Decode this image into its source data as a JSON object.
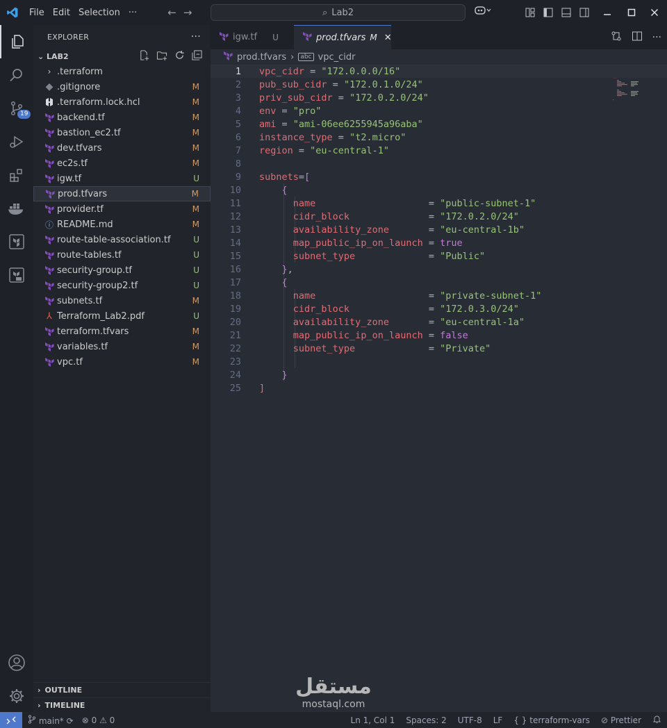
{
  "titlebar": {
    "menu": [
      "File",
      "Edit",
      "Selection",
      "···"
    ],
    "search": "Lab2"
  },
  "activity": {
    "source_control_badge": "19"
  },
  "explorer": {
    "title": "EXPLORER",
    "folder": "LAB2",
    "files": [
      {
        "name": ".terraform",
        "status": "",
        "kind": "folder"
      },
      {
        "name": ".gitignore",
        "status": "M",
        "kind": "git"
      },
      {
        "name": ".terraform.lock.hcl",
        "status": "M",
        "kind": "hcl"
      },
      {
        "name": "backend.tf",
        "status": "M",
        "kind": "tf"
      },
      {
        "name": "bastion_ec2.tf",
        "status": "M",
        "kind": "tf"
      },
      {
        "name": "dev.tfvars",
        "status": "M",
        "kind": "tf"
      },
      {
        "name": "ec2s.tf",
        "status": "M",
        "kind": "tf"
      },
      {
        "name": "igw.tf",
        "status": "U",
        "kind": "tf"
      },
      {
        "name": "prod.tfvars",
        "status": "M",
        "kind": "tf"
      },
      {
        "name": "provider.tf",
        "status": "M",
        "kind": "tf"
      },
      {
        "name": "README.md",
        "status": "M",
        "kind": "info"
      },
      {
        "name": "route-table-association.tf",
        "status": "U",
        "kind": "tf"
      },
      {
        "name": "route-tables.tf",
        "status": "U",
        "kind": "tf"
      },
      {
        "name": "security-group.tf",
        "status": "U",
        "kind": "tf"
      },
      {
        "name": "security-group2.tf",
        "status": "U",
        "kind": "tf"
      },
      {
        "name": "subnets.tf",
        "status": "M",
        "kind": "tf"
      },
      {
        "name": "Terraform_Lab2.pdf",
        "status": "U",
        "kind": "pdf"
      },
      {
        "name": "terraform.tfvars",
        "status": "M",
        "kind": "tf"
      },
      {
        "name": "variables.tf",
        "status": "M",
        "kind": "tf"
      },
      {
        "name": "vpc.tf",
        "status": "M",
        "kind": "tf"
      }
    ],
    "selected": "prod.tfvars",
    "outline": "OUTLINE",
    "timeline": "TIMELINE"
  },
  "tabs": [
    {
      "name": "igw.tf",
      "mark": "U",
      "active": false
    },
    {
      "name": "prod.tfvars",
      "mark": "M",
      "active": true
    }
  ],
  "breadcrumb": {
    "file": "prod.tfvars",
    "symbol": "vpc_cidr"
  },
  "code": [
    {
      "n": "1",
      "t": [
        [
          "k",
          "vpc_cidr"
        ],
        [
          "o",
          " = "
        ],
        [
          "s",
          "\"172.0.0.0/16\""
        ]
      ]
    },
    {
      "n": "2",
      "t": [
        [
          "k",
          "pub_sub_cidr"
        ],
        [
          "o",
          " = "
        ],
        [
          "s",
          "\"172.0.1.0/24\""
        ]
      ]
    },
    {
      "n": "3",
      "t": [
        [
          "k",
          "priv_sub_cidr"
        ],
        [
          "o",
          " = "
        ],
        [
          "s",
          "\"172.0.2.0/24\""
        ]
      ]
    },
    {
      "n": "4",
      "t": [
        [
          "k",
          "env"
        ],
        [
          "o",
          " = "
        ],
        [
          "s",
          "\"pro\""
        ]
      ]
    },
    {
      "n": "5",
      "t": [
        [
          "k",
          "ami"
        ],
        [
          "o",
          " = "
        ],
        [
          "s",
          "\"ami-06ee6255945a96aba\""
        ]
      ]
    },
    {
      "n": "6",
      "t": [
        [
          "k",
          "instance_type"
        ],
        [
          "o",
          " = "
        ],
        [
          "s",
          "\"t2.micro\""
        ]
      ]
    },
    {
      "n": "7",
      "t": [
        [
          "k",
          "region"
        ],
        [
          "o",
          " = "
        ],
        [
          "s",
          "\"eu-central-1\""
        ]
      ]
    },
    {
      "n": "8",
      "t": []
    },
    {
      "n": "9",
      "t": [
        [
          "k",
          "subnets"
        ],
        [
          "o",
          "="
        ],
        [
          "p",
          "["
        ]
      ]
    },
    {
      "n": "10",
      "t": [
        [
          "o",
          "    "
        ],
        [
          "b",
          "{"
        ]
      ]
    },
    {
      "n": "11",
      "t": [
        [
          "o",
          "      "
        ],
        [
          "k",
          "name"
        ],
        [
          "o",
          "                    = "
        ],
        [
          "s",
          "\"public-subnet-1\""
        ]
      ]
    },
    {
      "n": "12",
      "t": [
        [
          "o",
          "      "
        ],
        [
          "k",
          "cidr_block"
        ],
        [
          "o",
          "              = "
        ],
        [
          "s",
          "\"172.0.2.0/24\""
        ]
      ]
    },
    {
      "n": "13",
      "t": [
        [
          "o",
          "      "
        ],
        [
          "k",
          "availability_zone"
        ],
        [
          "o",
          "       = "
        ],
        [
          "s",
          "\"eu-central-1b\""
        ]
      ]
    },
    {
      "n": "14",
      "t": [
        [
          "o",
          "      "
        ],
        [
          "k",
          "map_public_ip_on_launch"
        ],
        [
          "o",
          " = "
        ],
        [
          "b",
          "true"
        ]
      ]
    },
    {
      "n": "15",
      "t": [
        [
          "o",
          "      "
        ],
        [
          "k",
          "subnet_type"
        ],
        [
          "o",
          "             = "
        ],
        [
          "s",
          "\"Public\""
        ]
      ]
    },
    {
      "n": "16",
      "t": [
        [
          "o",
          "    "
        ],
        [
          "b",
          "}"
        ],
        [
          "o",
          ","
        ]
      ]
    },
    {
      "n": "17",
      "t": [
        [
          "o",
          "    "
        ],
        [
          "b",
          "{"
        ]
      ]
    },
    {
      "n": "18",
      "t": [
        [
          "o",
          "      "
        ],
        [
          "k",
          "name"
        ],
        [
          "o",
          "                    = "
        ],
        [
          "s",
          "\"private-subnet-1\""
        ]
      ]
    },
    {
      "n": "19",
      "t": [
        [
          "o",
          "      "
        ],
        [
          "k",
          "cidr_block"
        ],
        [
          "o",
          "              = "
        ],
        [
          "s",
          "\"172.0.3.0/24\""
        ]
      ]
    },
    {
      "n": "20",
      "t": [
        [
          "o",
          "      "
        ],
        [
          "k",
          "availability_zone"
        ],
        [
          "o",
          "       = "
        ],
        [
          "s",
          "\"eu-central-1a\""
        ]
      ]
    },
    {
      "n": "21",
      "t": [
        [
          "o",
          "      "
        ],
        [
          "k",
          "map_public_ip_on_launch"
        ],
        [
          "o",
          " = "
        ],
        [
          "b",
          "false"
        ]
      ]
    },
    {
      "n": "22",
      "t": [
        [
          "o",
          "      "
        ],
        [
          "k",
          "subnet_type"
        ],
        [
          "o",
          "             = "
        ],
        [
          "s",
          "\"Private\""
        ]
      ]
    },
    {
      "n": "23",
      "t": []
    },
    {
      "n": "24",
      "t": [
        [
          "o",
          "    "
        ],
        [
          "b",
          "}"
        ]
      ]
    },
    {
      "n": "25",
      "t": [
        [
          "k",
          "]"
        ]
      ]
    }
  ],
  "statusbar": {
    "branch": "main*",
    "problems": "0",
    "warnings": "0",
    "position": "Ln 1, Col 1",
    "spaces": "Spaces: 2",
    "encoding": "UTF-8",
    "eol": "LF",
    "language": "terraform-vars",
    "formatter": "Prettier"
  },
  "watermark": {
    "arabic": "مستقل",
    "latin": "mostaql.com"
  },
  "colors": {
    "accent": "#4d78cc",
    "terraform": "#844fba",
    "modified": "#d19a66",
    "untracked": "#98c379"
  }
}
